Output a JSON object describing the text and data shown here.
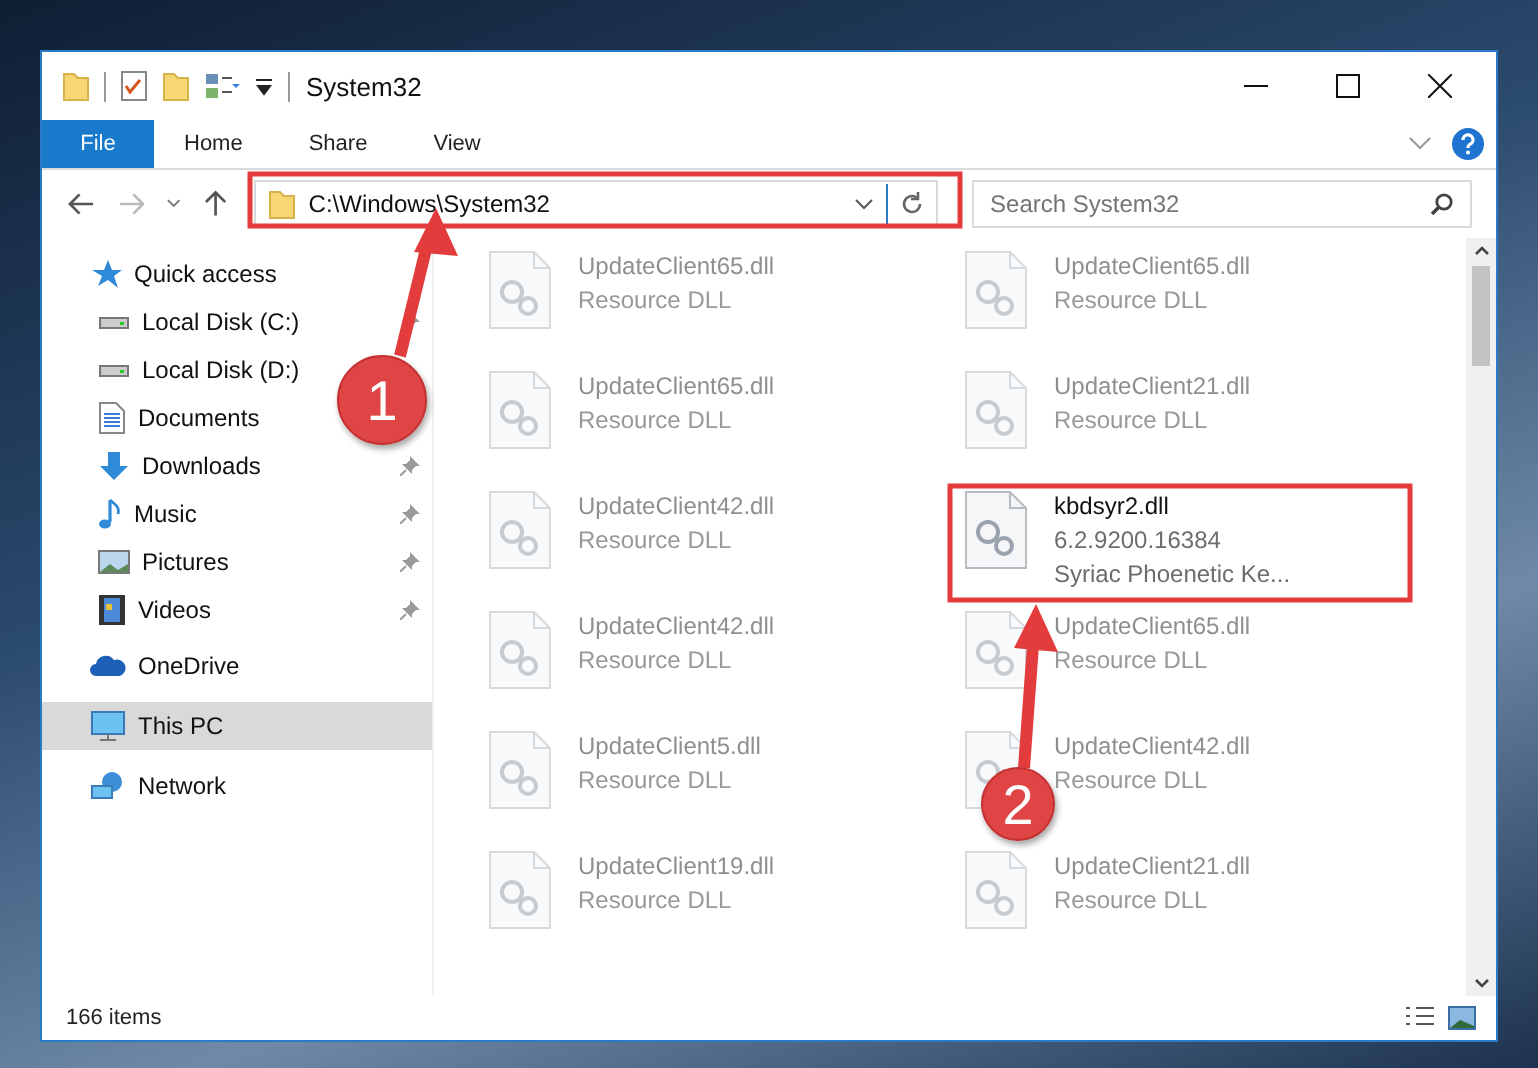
{
  "window": {
    "title": "System32"
  },
  "ribbon": {
    "tabs": [
      {
        "label": "File",
        "selected": true
      },
      {
        "label": "Home",
        "selected": false
      },
      {
        "label": "Share",
        "selected": false
      },
      {
        "label": "View",
        "selected": false
      }
    ]
  },
  "address": {
    "path": "C:\\Windows\\System32"
  },
  "search": {
    "placeholder": "Search System32"
  },
  "sidebar": {
    "items": [
      {
        "label": "Quick access",
        "selected": false,
        "children": [
          {
            "label": "Local Disk (C:)",
            "pinned": true
          },
          {
            "label": "Local Disk (D:)"
          },
          {
            "label": "Documents"
          },
          {
            "label": "Downloads",
            "pinned": true
          },
          {
            "label": "Music",
            "pinned": true
          },
          {
            "label": "Pictures",
            "pinned": true
          },
          {
            "label": "Videos",
            "pinned": true
          }
        ]
      },
      {
        "label": "OneDrive",
        "selected": false
      },
      {
        "label": "This PC",
        "selected": true
      },
      {
        "label": "Network",
        "selected": false
      }
    ]
  },
  "files": [
    {
      "name": "UpdateClient65.dll",
      "description": "Resource DLL",
      "blurred": true
    },
    {
      "name": "UpdateClient65.dll",
      "description": "Resource DLL",
      "blurred": true
    },
    {
      "name": "UpdateClient65.dll",
      "description": "Resource DLL",
      "blurred": true
    },
    {
      "name": "UpdateClient21.dll",
      "description": "Resource DLL",
      "blurred": true
    },
    {
      "name": "UpdateClient42.dll",
      "description": "Resource DLL",
      "blurred": true
    },
    {
      "name": "kbdsyr2.dll",
      "version": "6.2.9200.16384",
      "description": "Syriac Phoenetic Ke...",
      "blurred": false
    },
    {
      "name": "UpdateClient42.dll",
      "description": "Resource DLL",
      "blurred": true
    },
    {
      "name": "UpdateClient65.dll",
      "description": "Resource DLL",
      "blurred": true
    },
    {
      "name": "UpdateClient5.dll",
      "description": "Resource DLL",
      "blurred": true
    },
    {
      "name": "UpdateClient42.dll",
      "description": "Resource DLL",
      "blurred": true
    },
    {
      "name": "UpdateClient19.dll",
      "description": "Resource DLL",
      "blurred": true
    },
    {
      "name": "UpdateClient21.dll",
      "description": "Resource DLL",
      "blurred": true
    }
  ],
  "status_bar": {
    "count": "166 items"
  },
  "annotations": [
    {
      "number": "1"
    },
    {
      "number": "2"
    }
  ]
}
